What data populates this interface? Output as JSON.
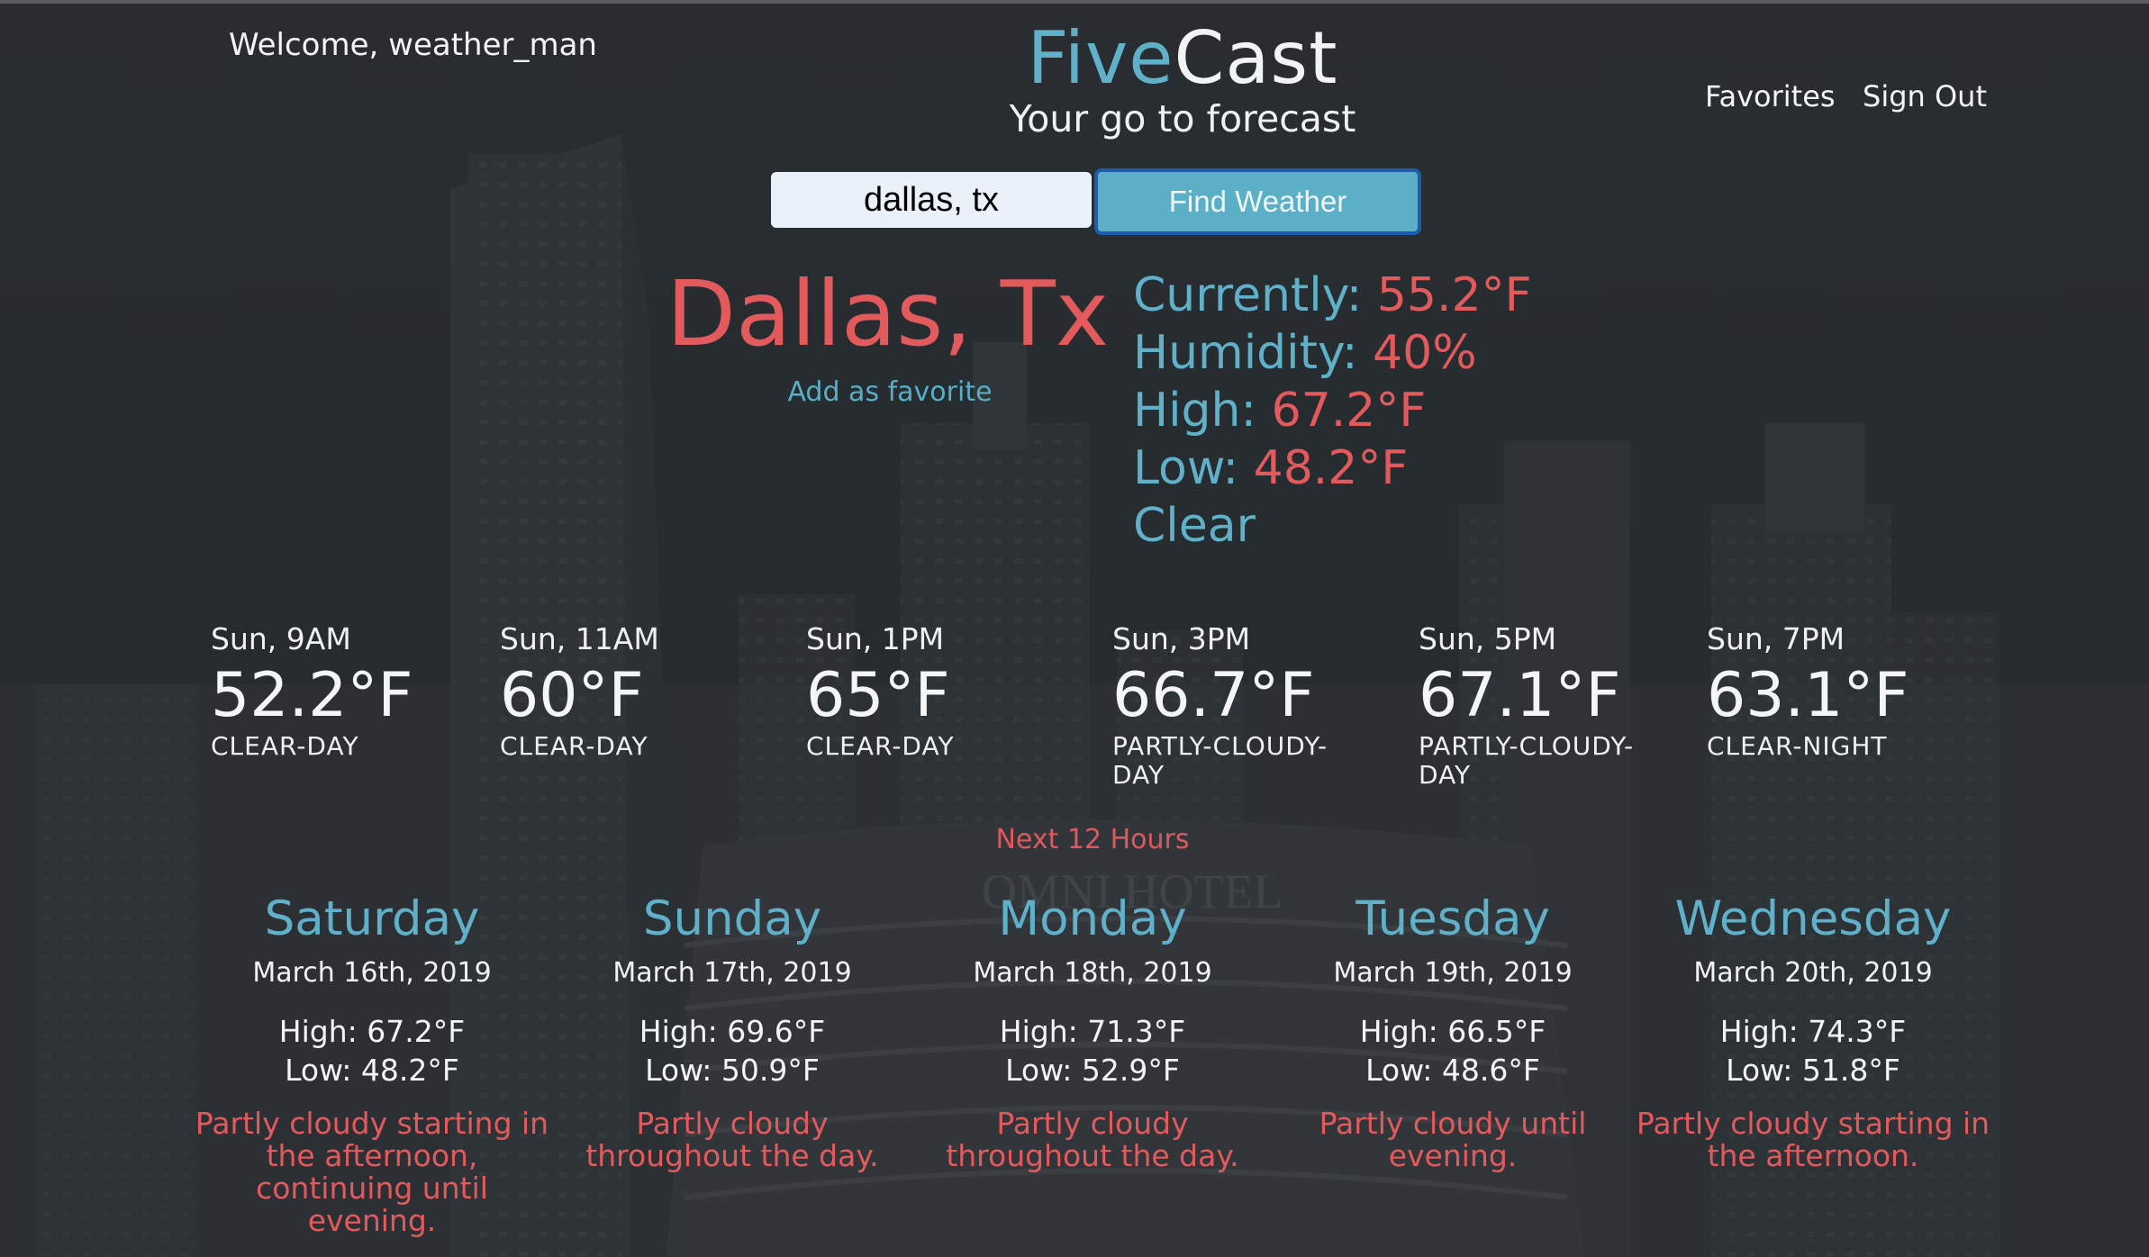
{
  "header": {
    "welcome": "Welcome, weather_man",
    "brand_part1": "Five",
    "brand_part2": "Cast",
    "tagline": "Your go to forecast",
    "nav": {
      "favorites": "Favorites",
      "sign_out": "Sign Out"
    }
  },
  "search": {
    "value": "dallas, tx",
    "button_label": "Find Weather"
  },
  "location": {
    "city": "Dallas, Tx",
    "add_favorite": "Add as favorite"
  },
  "current": {
    "currently_label": "Currently:",
    "currently_value": "55.2°F",
    "humidity_label": "Humidity:",
    "humidity_value": "40%",
    "high_label": "High:",
    "high_value": "67.2°F",
    "low_label": "Low:",
    "low_value": "48.2°F",
    "summary": "Clear"
  },
  "hourly": [
    {
      "time": "Sun, 9AM",
      "temp": "52.2°F",
      "summary": "CLEAR-DAY"
    },
    {
      "time": "Sun, 11AM",
      "temp": "60°F",
      "summary": "CLEAR-DAY"
    },
    {
      "time": "Sun, 1PM",
      "temp": "65°F",
      "summary": "CLEAR-DAY"
    },
    {
      "time": "Sun, 3PM",
      "temp": "66.7°F",
      "summary": "PARTLY-CLOUDY-DAY"
    },
    {
      "time": "Sun, 5PM",
      "temp": "67.1°F",
      "summary": "PARTLY-CLOUDY-DAY"
    },
    {
      "time": "Sun, 7PM",
      "temp": "63.1°F",
      "summary": "CLEAR-NIGHT"
    }
  ],
  "hourly_caption": "Next 12 Hours",
  "daily": [
    {
      "day": "Saturday",
      "date": "March 16th, 2019",
      "high": "High: 67.2°F",
      "low": "Low: 48.2°F",
      "summary": "Partly cloudy starting in the afternoon, continuing until evening."
    },
    {
      "day": "Sunday",
      "date": "March 17th, 2019",
      "high": "High: 69.6°F",
      "low": "Low: 50.9°F",
      "summary": "Partly cloudy throughout the day."
    },
    {
      "day": "Monday",
      "date": "March 18th, 2019",
      "high": "High: 71.3°F",
      "low": "Low: 52.9°F",
      "summary": "Partly cloudy throughout the day."
    },
    {
      "day": "Tuesday",
      "date": "March 19th, 2019",
      "high": "High: 66.5°F",
      "low": "Low: 48.6°F",
      "summary": "Partly cloudy until evening."
    },
    {
      "day": "Wednesday",
      "date": "March 20th, 2019",
      "high": "High: 74.3°F",
      "low": "Low: 51.8°F",
      "summary": "Partly cloudy starting in the afternoon."
    }
  ],
  "background": {
    "sign_text": "OMNI HOTEL"
  },
  "colors": {
    "accent_teal": "#5fb0c8",
    "accent_red": "#e35a5d",
    "button_border": "#1e5dae",
    "background": "#2b3035"
  }
}
